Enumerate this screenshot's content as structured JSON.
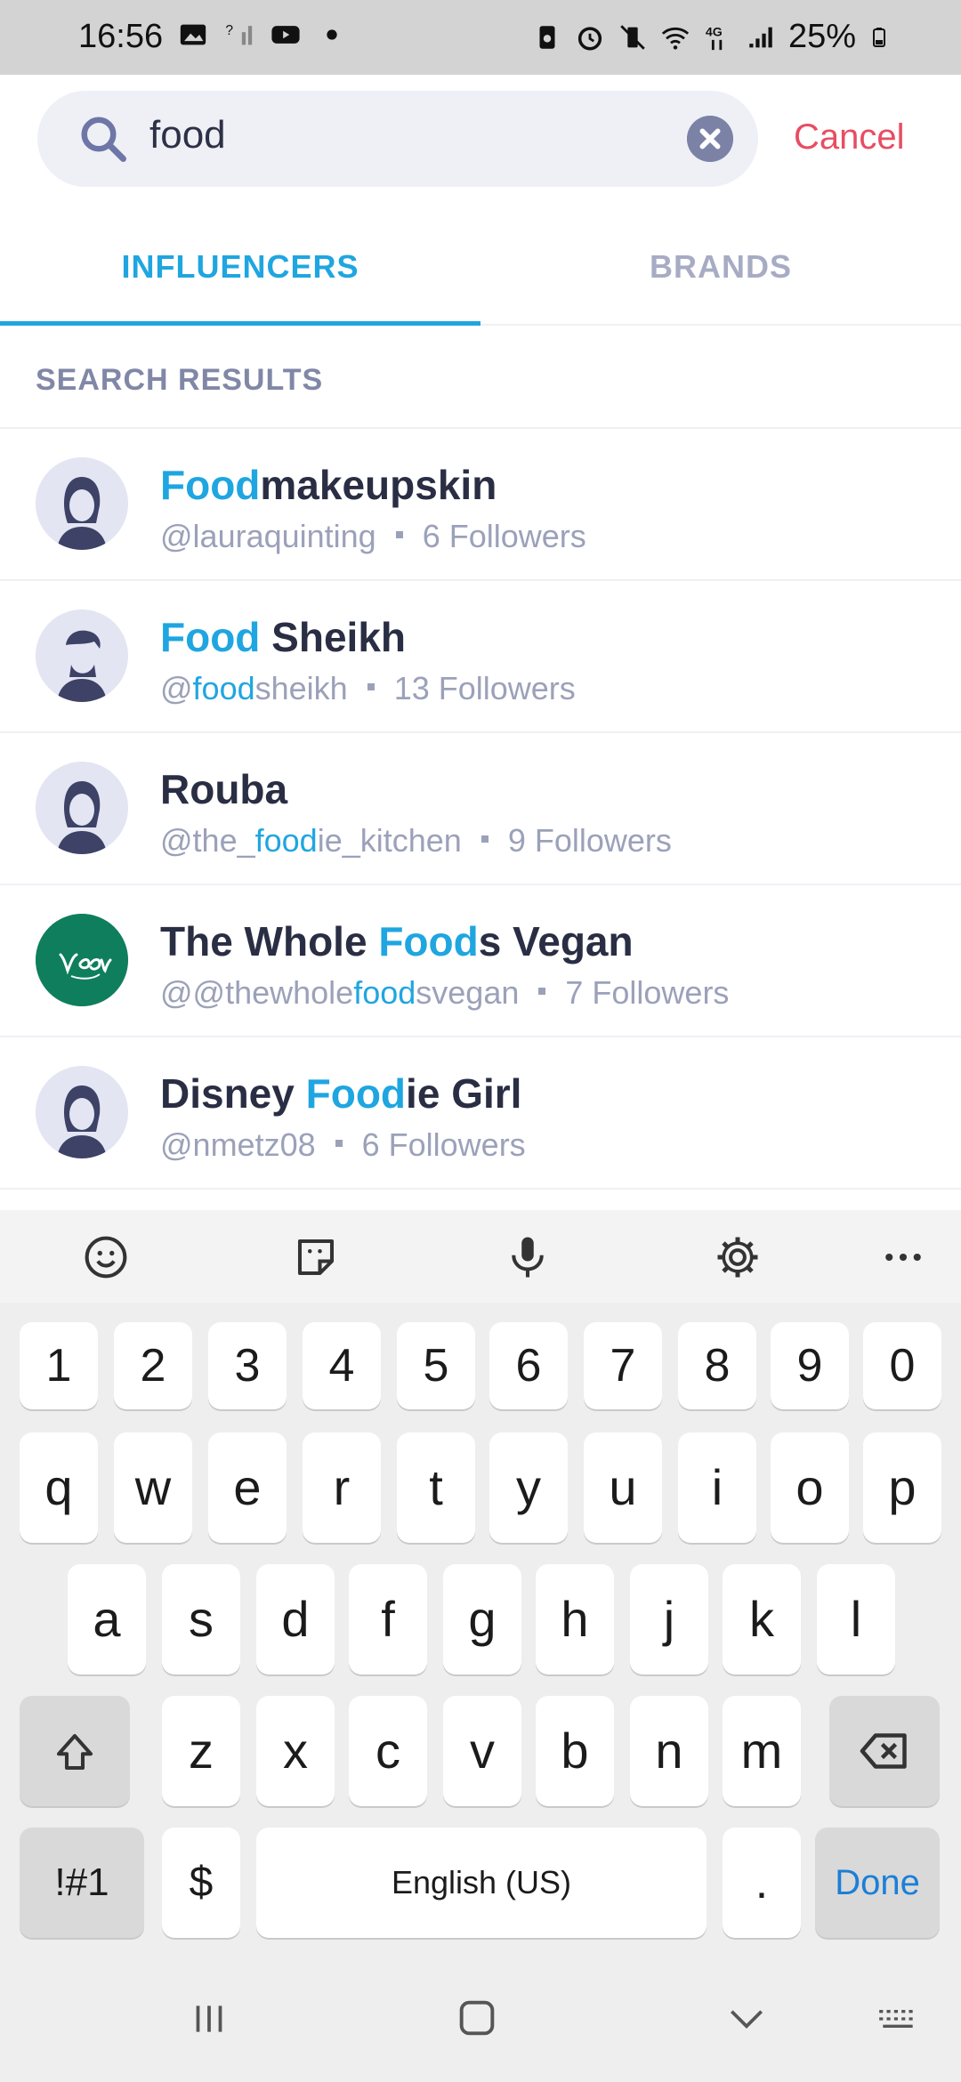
{
  "status_bar": {
    "time": "16:56",
    "battery": "25%",
    "network": "4G"
  },
  "search": {
    "query": "food",
    "cancel_label": "Cancel"
  },
  "tabs": [
    {
      "label": "INFLUENCERS",
      "active": true
    },
    {
      "label": "BRANDS",
      "active": false
    }
  ],
  "section_label": "SEARCH RESULTS",
  "results": [
    {
      "name_highlight": "Food",
      "name_rest": "makeupskin",
      "name_pre": "",
      "handle_pre": "@lauraquinting",
      "handle_highlight": "",
      "handle_post": "",
      "followers": "6 Followers",
      "avatar": "woman-icon"
    },
    {
      "name_highlight": "Food",
      "name_rest": " Sheikh",
      "name_pre": "",
      "handle_pre": "@",
      "handle_highlight": "food",
      "handle_post": "sheikh",
      "followers": "13 Followers",
      "avatar": "man-icon"
    },
    {
      "name_highlight": "",
      "name_rest": "Rouba",
      "name_pre": "",
      "handle_pre": "@the_",
      "handle_highlight": "food",
      "handle_post": "ie_kitchen",
      "followers": "9 Followers",
      "avatar": "woman-icon"
    },
    {
      "name_highlight": "Food",
      "name_rest": "s Vegan",
      "name_pre": "The Whole ",
      "handle_pre": "@@thewhole",
      "handle_highlight": "food",
      "handle_post": "svegan",
      "followers": "7 Followers",
      "avatar": "vegan-logo"
    },
    {
      "name_highlight": "Food",
      "name_rest": "ie Girl",
      "name_pre": "Disney ",
      "handle_pre": "@nmetz08",
      "handle_highlight": "",
      "handle_post": "",
      "followers": "6 Followers",
      "avatar": "woman-icon"
    }
  ],
  "keyboard": {
    "numbers": [
      "1",
      "2",
      "3",
      "4",
      "5",
      "6",
      "7",
      "8",
      "9",
      "0"
    ],
    "row1": [
      "q",
      "w",
      "e",
      "r",
      "t",
      "y",
      "u",
      "i",
      "o",
      "p"
    ],
    "row2": [
      "a",
      "s",
      "d",
      "f",
      "g",
      "h",
      "j",
      "k",
      "l"
    ],
    "row3": [
      "z",
      "x",
      "c",
      "v",
      "b",
      "n",
      "m"
    ],
    "symbols_label": "!#1",
    "currency_label": "$",
    "space_label": "English (US)",
    "period_label": ".",
    "done_label": "Done"
  },
  "colors": {
    "accent": "#1fa6e0",
    "cancel": "#e84d62",
    "vegan_bg": "#0f7e5c"
  }
}
